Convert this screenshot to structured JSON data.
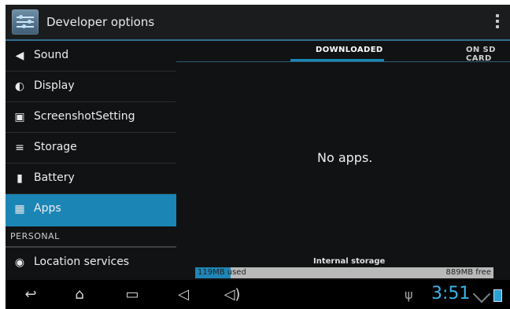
{
  "action_bar": {
    "title": "Developer options",
    "icon": "developer-options-icon",
    "overflow_icon": "overflow-menu-icon"
  },
  "settings": {
    "items": [
      {
        "label": "Sound",
        "icon": "sound-icon"
      },
      {
        "label": "Display",
        "icon": "display-icon"
      },
      {
        "label": "ScreenshotSetting",
        "icon": "camera-icon"
      },
      {
        "label": "Storage",
        "icon": "storage-icon"
      },
      {
        "label": "Battery",
        "icon": "battery-icon"
      },
      {
        "label": "Apps",
        "icon": "apps-icon",
        "selected": true
      }
    ],
    "section_personal": "PERSONAL",
    "location_item": {
      "label": "Location services",
      "icon": "location-icon"
    }
  },
  "apps": {
    "tabs": [
      {
        "label": "DOWNLOADED",
        "active": true
      },
      {
        "label": "ON SD CARD",
        "active": false
      }
    ],
    "empty_message": "No apps.",
    "storage": {
      "title": "Internal storage",
      "used_label": "119MB used",
      "free_label": "889MB free",
      "used_fraction": 0.118
    }
  },
  "status_bar": {
    "time": "3:51",
    "usb_icon": "usb-icon",
    "wifi_icon": "wifi-icon",
    "battery_icon": "battery-charging-icon"
  },
  "nav": {
    "buttons": [
      "back-icon",
      "home-icon",
      "recent-apps-icon",
      "volume-down-icon",
      "volume-up-icon"
    ]
  },
  "colors": {
    "accent": "#1b86b6",
    "clock": "#37b4ea",
    "background": "#111214"
  }
}
